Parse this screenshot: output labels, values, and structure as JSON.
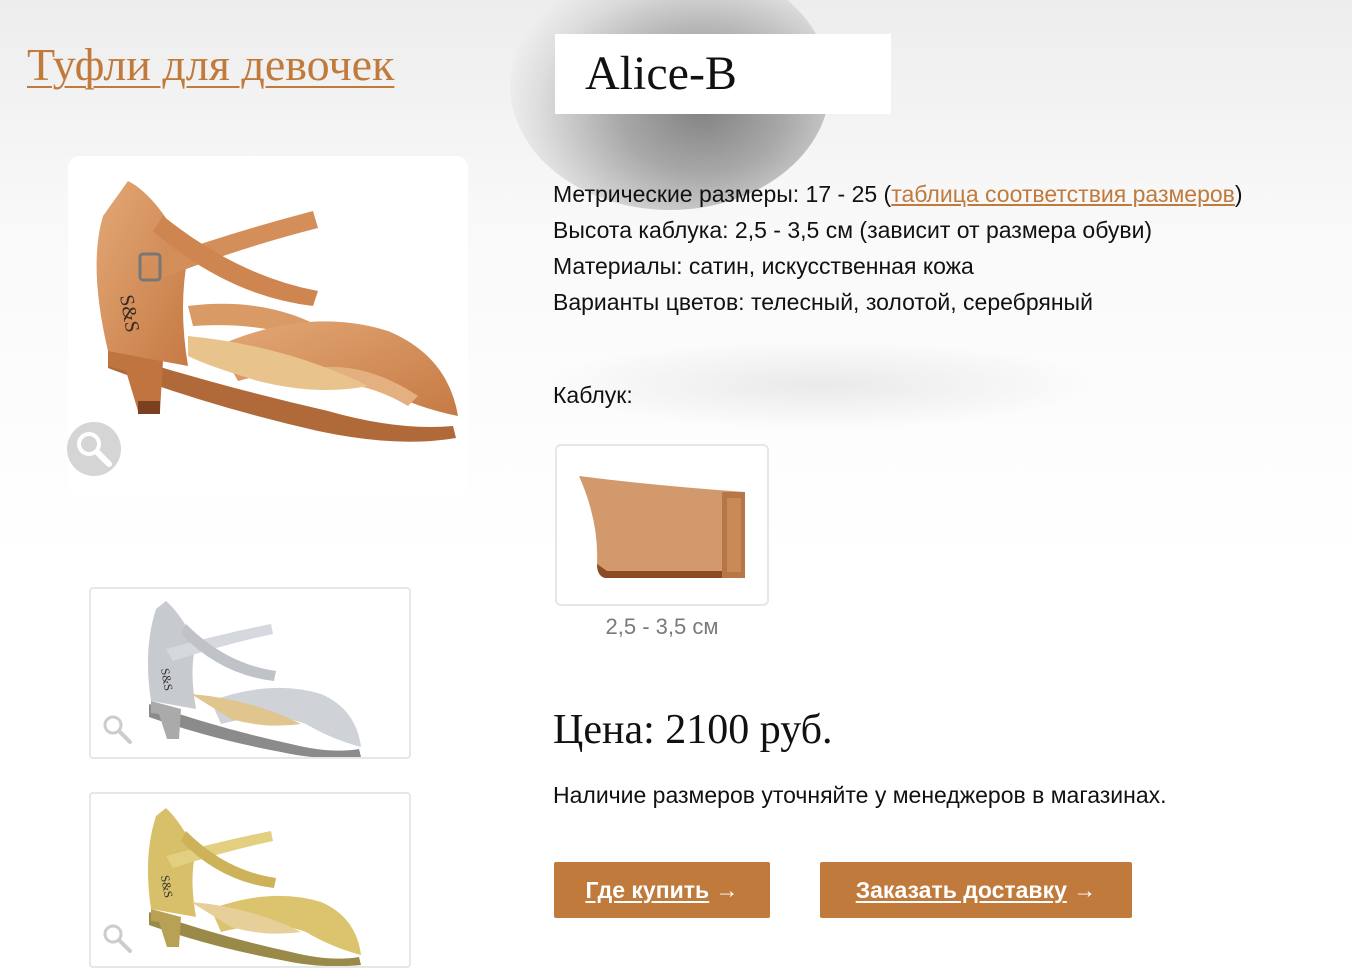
{
  "header": {
    "category_link": "Туфли для девочек",
    "product_title": "Alice-B"
  },
  "specs": {
    "sizes_label": "Метрические размеры: 17 - 25 (",
    "sizes_link": "таблица соответствия размеров",
    "sizes_close": ")",
    "heel_height": "Высота каблука: 2,5 - 3,5 см (зависит от размера обуви)",
    "materials": "Материалы: сатин, искусственная кожа",
    "colors": "Варианты цветов: телесный, золотой, серебряный"
  },
  "heel": {
    "label": "Каблук:",
    "caption": "2,5 - 3,5 см"
  },
  "price": "Цена: 2100 руб.",
  "availability": "Наличие размеров уточняйте у менеджеров в магазинах.",
  "buttons": {
    "where_to_buy": "Где купить",
    "order_delivery": "Заказать доставку",
    "arrow": "→"
  },
  "images": {
    "main_color": "#d9935f",
    "thumb1_color": "#c9cdd2",
    "thumb2_color": "#d8c06a",
    "heel_color": "#d29a6c"
  },
  "colors": {
    "accent": "#c07a3c"
  },
  "icons": {
    "zoom": "magnifier-icon",
    "arrow": "arrow-right-icon"
  }
}
